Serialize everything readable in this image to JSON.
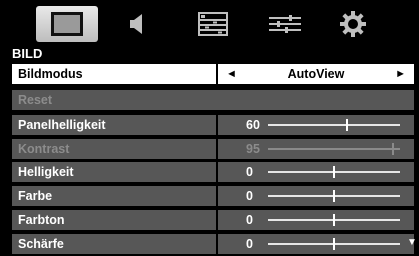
{
  "tabs": [
    {
      "icon": "picture-icon",
      "selected": true
    },
    {
      "icon": "speaker-icon",
      "selected": false
    },
    {
      "icon": "list-icon",
      "selected": false
    },
    {
      "icon": "equalizer-icon",
      "selected": false
    },
    {
      "icon": "gear-icon",
      "selected": false
    }
  ],
  "section_title": "BILD",
  "bildmodus": {
    "label": "Bildmodus",
    "value": "AutoView",
    "left_arrow": "◄",
    "right_arrow": "►"
  },
  "reset": {
    "label": "Reset"
  },
  "settings": [
    {
      "label": "Panelhelligkeit",
      "value": "60",
      "level": 0.6,
      "enabled": true
    },
    {
      "label": "Kontrast",
      "value": "95",
      "level": 0.95,
      "enabled": false
    },
    {
      "label": "Helligkeit",
      "value": "0",
      "level": 0.5,
      "enabled": true
    },
    {
      "label": "Farbe",
      "value": "0",
      "level": 0.5,
      "enabled": true
    },
    {
      "label": "Farbton",
      "value": "0",
      "level": 0.5,
      "enabled": true
    },
    {
      "label": "Schärfe",
      "value": "0",
      "level": 0.5,
      "enabled": true
    }
  ],
  "scroll_down": "▼"
}
